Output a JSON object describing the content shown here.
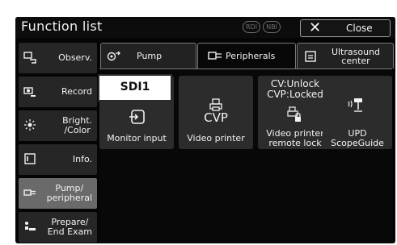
{
  "header": {
    "title": "Function list",
    "badges": [
      "RDI",
      "NBI"
    ],
    "close_label": "Close"
  },
  "sidebar": {
    "items": [
      {
        "label": "Observ.",
        "icon": "observation-monitor-icon",
        "active": false
      },
      {
        "label": "Record",
        "icon": "record-camera-icon",
        "active": false
      },
      {
        "label": "Bright.\n/Color",
        "icon": "brightness-icon",
        "active": false
      },
      {
        "label": "Info.",
        "icon": "info-screen-icon",
        "active": false
      },
      {
        "label": "Pump/\nperipheral",
        "icon": "peripheral-connector-icon",
        "active": true
      },
      {
        "label": "Prepare/\nEnd Exam",
        "icon": "patient-bed-icon",
        "active": false
      }
    ]
  },
  "tabs": [
    {
      "label": "Pump",
      "icon": "pump-icon",
      "active": false
    },
    {
      "label": "Peripherals",
      "icon": "peripheral-connector-icon",
      "active": true
    },
    {
      "label": "Ultrasound\ncenter",
      "icon": "ultrasound-screen-icon",
      "active": false
    }
  ],
  "buttons": [
    {
      "top_text": "SDI1",
      "icon": "monitor-input-icon",
      "label": "Monitor input"
    },
    {
      "top_text": "CVP",
      "icon": "printer-icon",
      "label": "Video printer"
    },
    {
      "top_text": "CV:Unlock\nCVP:Locked",
      "icon": "printer-lock-icon",
      "label": "Video printer\nremote lock"
    },
    {
      "top_text": "",
      "icon": "scopeguide-icon",
      "label": "UPD\nScopeGuide"
    }
  ]
}
